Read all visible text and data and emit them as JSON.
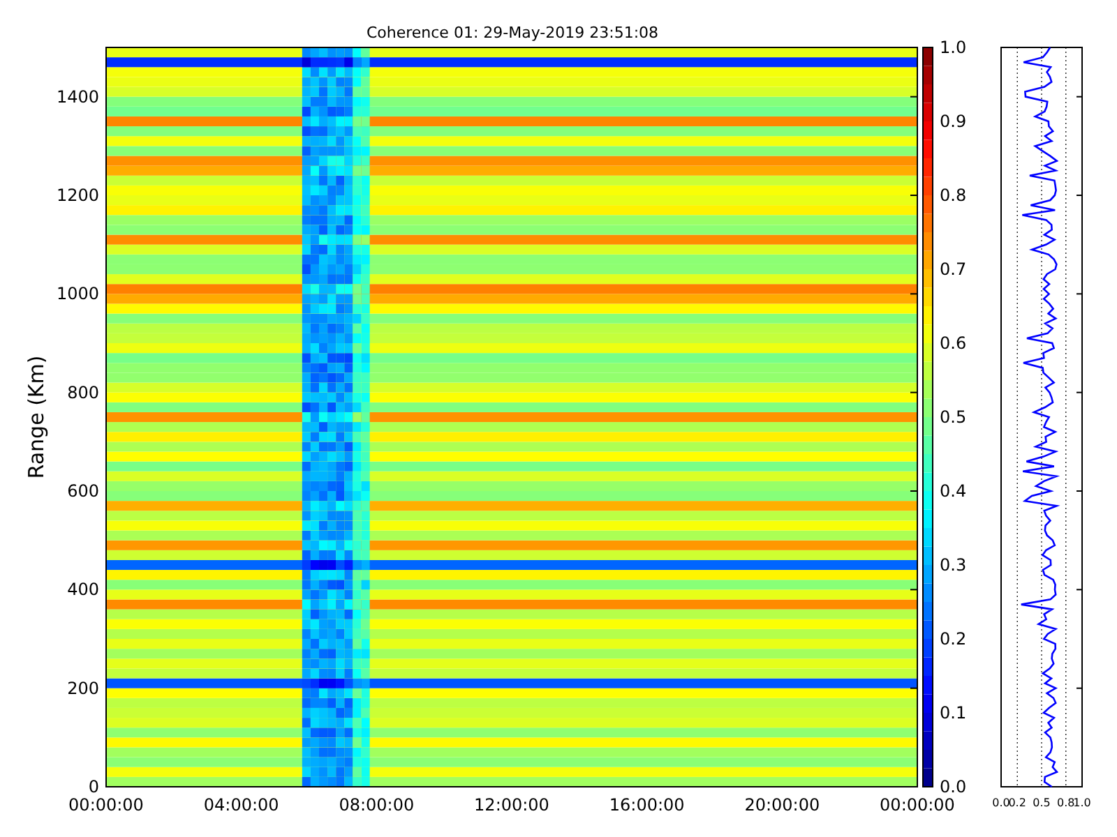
{
  "title": "Coherence 01: 29-May-2019 23:51:08",
  "heatmap": {
    "ylabel": "Range (Km)",
    "yticks": [
      "1400",
      "1200",
      "1000",
      "800",
      "600",
      "400",
      "200",
      "0"
    ],
    "xticks": [
      "00:00:00",
      "04:00:00",
      "08:00:00",
      "12:00:00",
      "16:00:00",
      "20:00:00",
      "00:00:00"
    ]
  },
  "colorbar": {
    "ticks": [
      "1.0",
      "0.9",
      "0.8",
      "0.7",
      "0.6",
      "0.5",
      "0.4",
      "0.3",
      "0.2",
      "0.1",
      "0.0"
    ]
  },
  "profile": {
    "xticks": [
      "0.0",
      "0.2",
      "0.5",
      "0.8",
      "1.0"
    ]
  }
}
